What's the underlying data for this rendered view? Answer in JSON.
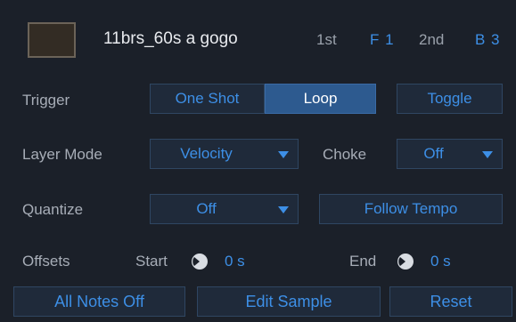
{
  "header": {
    "title": "11brs_60s a gogo",
    "first_label": "1st",
    "first_value": "F 1",
    "second_label": "2nd",
    "second_value": "B 3"
  },
  "trigger": {
    "label": "Trigger",
    "one_shot": "One Shot",
    "loop": "Loop",
    "toggle": "Toggle",
    "selected": "Loop"
  },
  "layer_mode": {
    "label": "Layer Mode",
    "value": "Velocity"
  },
  "choke": {
    "label": "Choke",
    "value": "Off"
  },
  "quantize": {
    "label": "Quantize",
    "value": "Off"
  },
  "follow_tempo": {
    "label": "Follow Tempo"
  },
  "offsets": {
    "label": "Offsets",
    "start_label": "Start",
    "start_value": "0 s",
    "end_label": "End",
    "end_value": "0 s"
  },
  "bottom": {
    "all_notes_off": "All Notes Off",
    "edit_sample": "Edit Sample",
    "reset": "Reset"
  },
  "colors": {
    "accent": "#3d8fe6",
    "active_button": "#2d5a8f",
    "background": "#1b2029"
  }
}
